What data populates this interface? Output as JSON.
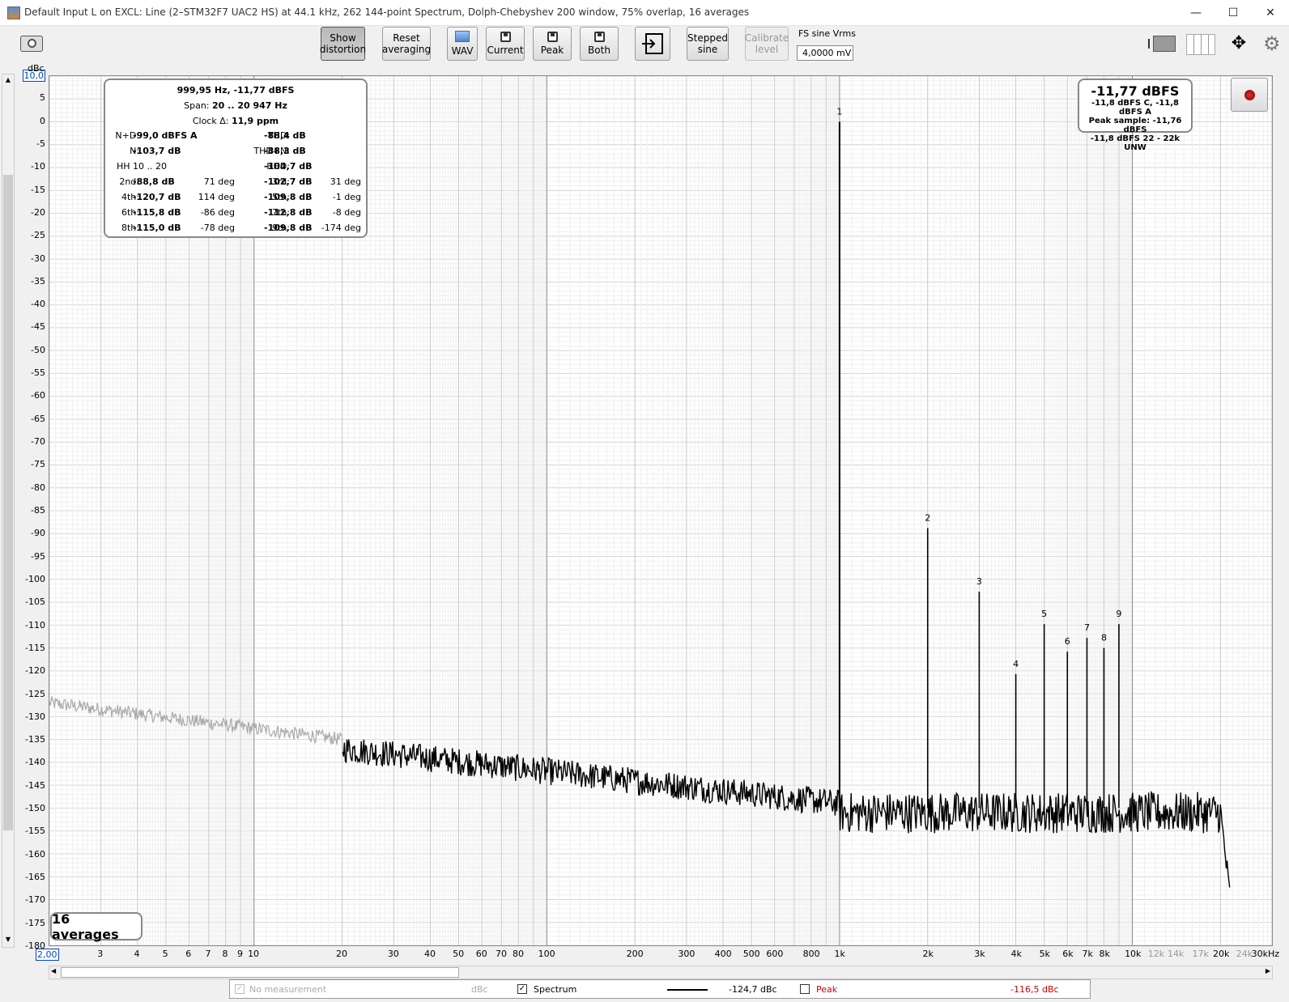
{
  "window": {
    "title": "Default Input L on EXCL: Line (2–STM32F7 UAC2 HS) at 44.1 kHz, 262 144-point Spectrum, Dolph-Chebyshev 200 window, 75% overlap, 16 averages",
    "minimize": "—",
    "maximize": "☐",
    "close": "✕"
  },
  "toolbar": {
    "show_distortion_1": "Show",
    "show_distortion_2": "distortion",
    "reset_averaging_1": "Reset",
    "reset_averaging_2": "averaging",
    "wav": "WAV",
    "current": "Current",
    "peak": "Peak",
    "both": "Both",
    "stepped_sine_1": "Stepped",
    "stepped_sine_2": "sine",
    "calibrate_1": "Calibrate",
    "calibrate_2": "level",
    "fs_sine_label": "FS sine Vrms",
    "fs_sine_value": "4,0000 mV"
  },
  "chart_data": {
    "type": "line",
    "ylabel": "dBc",
    "ylim": [
      -180,
      10
    ],
    "xlim": [
      2,
      30000
    ],
    "x_scale": "log",
    "yticks": [
      "10,0",
      "5",
      "0",
      "-5",
      "-10",
      "-15",
      "-20",
      "-25",
      "-30",
      "-35",
      "-40",
      "-45",
      "-50",
      "-55",
      "-60",
      "-65",
      "-70",
      "-75",
      "-80",
      "-85",
      "-90",
      "-95",
      "-100",
      "-105",
      "-110",
      "-115",
      "-120",
      "-125",
      "-130",
      "-135",
      "-140",
      "-145",
      "-150",
      "-155",
      "-160",
      "-165",
      "-170",
      "-175",
      "-180"
    ],
    "xticks": [
      {
        "v": 2,
        "l": "2,00"
      },
      {
        "v": 3,
        "l": "3"
      },
      {
        "v": 4,
        "l": "4"
      },
      {
        "v": 5,
        "l": "5"
      },
      {
        "v": 6,
        "l": "6"
      },
      {
        "v": 7,
        "l": "7"
      },
      {
        "v": 8,
        "l": "8"
      },
      {
        "v": 9,
        "l": "9"
      },
      {
        "v": 10,
        "l": "10"
      },
      {
        "v": 20,
        "l": "20"
      },
      {
        "v": 30,
        "l": "30"
      },
      {
        "v": 40,
        "l": "40"
      },
      {
        "v": 50,
        "l": "50"
      },
      {
        "v": 60,
        "l": "60"
      },
      {
        "v": 70,
        "l": "70"
      },
      {
        "v": 80,
        "l": "80"
      },
      {
        "v": 100,
        "l": "100"
      },
      {
        "v": 200,
        "l": "200"
      },
      {
        "v": 300,
        "l": "300"
      },
      {
        "v": 400,
        "l": "400"
      },
      {
        "v": 500,
        "l": "500"
      },
      {
        "v": 600,
        "l": "600"
      },
      {
        "v": 800,
        "l": "800"
      },
      {
        "v": 1000,
        "l": "1k"
      },
      {
        "v": 2000,
        "l": "2k"
      },
      {
        "v": 3000,
        "l": "3k"
      },
      {
        "v": 4000,
        "l": "4k"
      },
      {
        "v": 5000,
        "l": "5k"
      },
      {
        "v": 6000,
        "l": "6k"
      },
      {
        "v": 7000,
        "l": "7k"
      },
      {
        "v": 8000,
        "l": "8k"
      },
      {
        "v": 10000,
        "l": "10k"
      },
      {
        "v": 12000,
        "l": "12k"
      },
      {
        "v": 14000,
        "l": "14k"
      },
      {
        "v": 17000,
        "l": "17k"
      },
      {
        "v": 20000,
        "l": "20k"
      },
      {
        "v": 24000,
        "l": "24k"
      },
      {
        "v": 30000,
        "l": "30kHz"
      }
    ],
    "harmonics": [
      {
        "n": "1",
        "f": 1000,
        "db": 0
      },
      {
        "n": "2",
        "f": 2000,
        "db": -88.8
      },
      {
        "n": "3",
        "f": 3000,
        "db": -102.7
      },
      {
        "n": "4",
        "f": 4000,
        "db": -120.7
      },
      {
        "n": "5",
        "f": 5000,
        "db": -109.8
      },
      {
        "n": "6",
        "f": 6000,
        "db": -115.8
      },
      {
        "n": "7",
        "f": 7000,
        "db": -112.8
      },
      {
        "n": "8",
        "f": 8000,
        "db": -115.0
      },
      {
        "n": "9",
        "f": 9000,
        "db": -109.8
      }
    ],
    "series": [
      {
        "name": "Spectrum",
        "color": "#000000"
      }
    ]
  },
  "info": {
    "header": "999,95 Hz, -11,77 dBFS",
    "span_label": "Span:",
    "span_value": "20 .. 20 947 Hz",
    "clock_label": "Clock Δ:",
    "clock_value": "11,9 ppm",
    "rows": [
      {
        "l1": "N+D:",
        "v1": "-99,0 dBFS A",
        "l2": "THD:",
        "v2": "-88,4 dB",
        "d1": "",
        "d2": ""
      },
      {
        "l1": "N:",
        "v1": "-103,7 dB",
        "l2": "THD+N:",
        "v2": "-88,3 dB",
        "d1": "",
        "d2": ""
      },
      {
        "l1": "HH 10 .. 20",
        "v1": "",
        "l2": "HHD:",
        "v2": "-104,7 dB",
        "d1": "",
        "d2": ""
      },
      {
        "l1": "2nd:",
        "v1": "-88,8 dB",
        "d1": "71 deg",
        "l2": "3rd:",
        "v2": "-102,7 dB",
        "d2": "31 deg"
      },
      {
        "l1": "4th:",
        "v1": "-120,7 dB",
        "d1": "114 deg",
        "l2": "5th:",
        "v2": "-109,8 dB",
        "d2": "-1 deg"
      },
      {
        "l1": "6th:",
        "v1": "-115,8 dB",
        "d1": "-86 deg",
        "l2": "7th:",
        "v2": "-112,8 dB",
        "d2": "-8 deg"
      },
      {
        "l1": "8th:",
        "v1": "-115,0 dB",
        "d1": "-78 deg",
        "l2": "9th:",
        "v2": "-109,8 dB",
        "d2": "-174 deg"
      }
    ]
  },
  "level": {
    "main": "-11,77 dBFS",
    "line1": "-11,8 dBFS C, -11,8 dBFS A",
    "line2": "Peak sample: -11,76 dBFS",
    "line3": "-11,8 dBFS 22 - 22k UNW"
  },
  "averages": "16 averages",
  "legend": {
    "no_measurement": "No measurement",
    "no_measurement_unit": "dBc",
    "spectrum": "Spectrum",
    "spectrum_value": "-124,7 dBc",
    "peak": "Peak",
    "peak_value": "-116,5 dBc",
    "peak_color": "#cc0000"
  }
}
